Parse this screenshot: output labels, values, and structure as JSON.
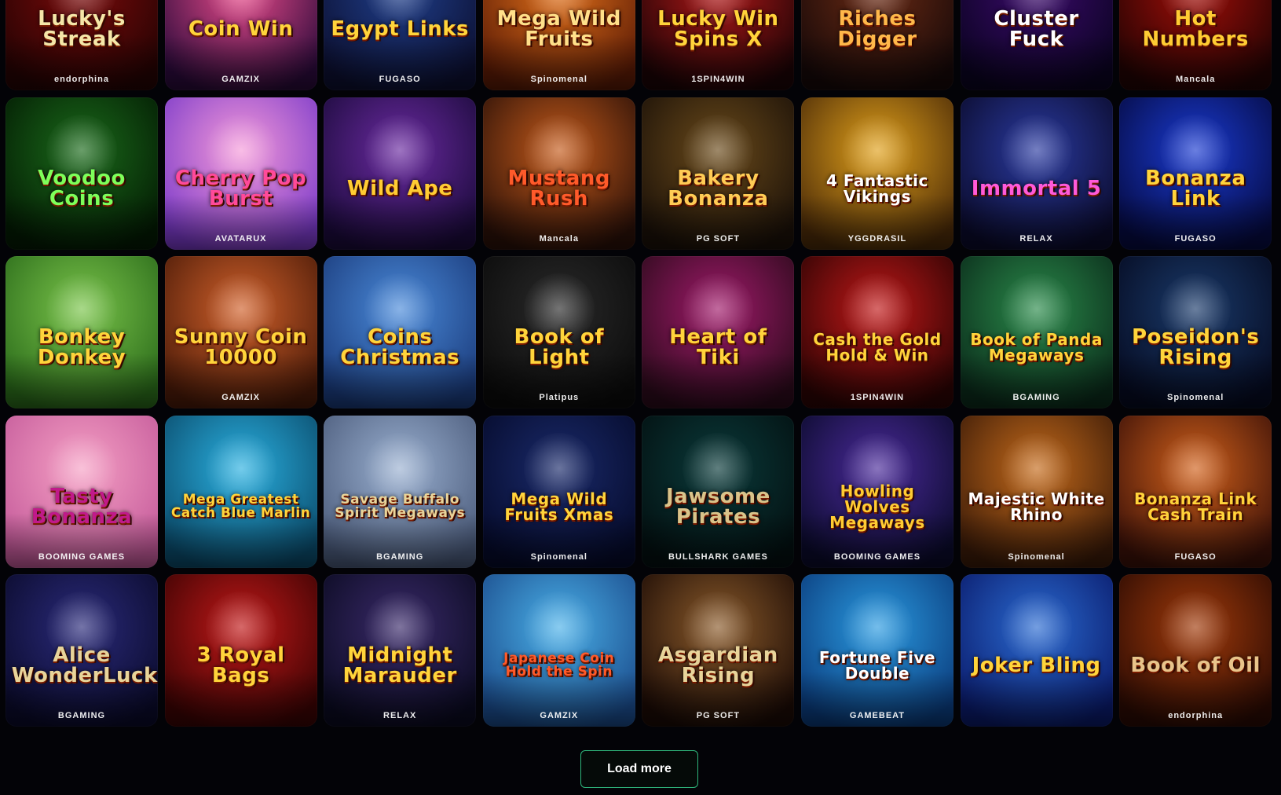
{
  "games": [
    {
      "title": "Lucky's Streak",
      "provider": "endorphina",
      "bg": [
        "#7a0a0a",
        "#240303"
      ],
      "color": "#f5e6a8",
      "art": "flames"
    },
    {
      "title": "Coin Win",
      "provider": "GAMZIX",
      "bg": [
        "#e84a8a",
        "#2a0a3a"
      ],
      "color": "#ffd43b",
      "art": "coins"
    },
    {
      "title": "Egypt Links",
      "provider": "FUGASO",
      "bg": [
        "#1f3e8a",
        "#0c0f30"
      ],
      "color": "#ffd43b",
      "art": "sun"
    },
    {
      "title": "Mega Wild Fruits",
      "provider": "Spinomenal",
      "bg": [
        "#e0701a",
        "#5a1a05"
      ],
      "color": "#ffe08a",
      "art": "crown"
    },
    {
      "title": "Lucky Win Spins X",
      "provider": "1SPIN4WIN",
      "bg": [
        "#b01818",
        "#1a0305"
      ],
      "color": "#ffd43b",
      "art": "fruit"
    },
    {
      "title": "Riches Digger",
      "provider": "",
      "bg": [
        "#6a2a14",
        "#150808"
      ],
      "color": "#ffb84a",
      "art": "miner"
    },
    {
      "title": "Cluster Fuck",
      "provider": "",
      "bg": [
        "#3a0a6a",
        "#0a0320"
      ],
      "color": "#ffffff",
      "art": "devil"
    },
    {
      "title": "Hot Numbers",
      "provider": "Mancala",
      "bg": [
        "#a10e08",
        "#200303"
      ],
      "color": "#ffcc33",
      "art": "flames"
    },
    {
      "title": "Voodoo Coins",
      "provider": "",
      "bg": [
        "#1a6a1a",
        "#031a03"
      ],
      "color": "#7dff5a",
      "art": "skull"
    },
    {
      "title": "Cherry Pop Burst",
      "provider": "AVATARUX",
      "bg": [
        "#f59ad9",
        "#7a3ac9"
      ],
      "color": "#ff4a9a",
      "art": "cherry"
    },
    {
      "title": "Wild Ape",
      "provider": "",
      "bg": [
        "#6a2aa0",
        "#1a0a3a"
      ],
      "color": "#ffcc33",
      "art": "ape"
    },
    {
      "title": "Mustang Rush",
      "provider": "Mancala",
      "bg": [
        "#c45a1a",
        "#2a1008"
      ],
      "color": "#ff5a2a",
      "art": "cowgirl"
    },
    {
      "title": "Bakery Bonanza",
      "provider": "PG SOFT",
      "bg": [
        "#6a4a1a",
        "#1a1008"
      ],
      "color": "#ffcc55",
      "art": "cake"
    },
    {
      "title": "4 Fantastic Vikings",
      "provider": "YGGDRASIL",
      "bg": [
        "#e0a01a",
        "#4a2a08"
      ],
      "color": "#ffffff",
      "art": "viking"
    },
    {
      "title": "Immortal 5",
      "provider": "RELAX",
      "bg": [
        "#2a3aa0",
        "#0a0a2a"
      ],
      "color": "#ff5ad9",
      "art": "heroes"
    },
    {
      "title": "Bonanza Link",
      "provider": "FUGASO",
      "bg": [
        "#1a3ad0",
        "#050a40"
      ],
      "color": "#ffd43b",
      "art": "dollar"
    },
    {
      "title": "Bonkey Donkey",
      "provider": "",
      "bg": [
        "#7ac44a",
        "#2a6a1a"
      ],
      "color": "#ffd43b",
      "art": "donkey"
    },
    {
      "title": "Sunny Coin 10000",
      "provider": "GAMZIX",
      "bg": [
        "#d0602a",
        "#4a1a08"
      ],
      "color": "#ffd43b",
      "art": "queen"
    },
    {
      "title": "Coins Christmas",
      "provider": "",
      "bg": [
        "#4a8ad9",
        "#1a3a7a"
      ],
      "color": "#ffd43b",
      "art": "snow"
    },
    {
      "title": "Book of Light",
      "provider": "Platipus",
      "bg": [
        "#2a2a2a",
        "#0a0a0a"
      ],
      "color": "#ffd43b",
      "art": "pharaoh"
    },
    {
      "title": "Heart of Tiki",
      "provider": "",
      "bg": [
        "#a01a6a",
        "#2a0a1a"
      ],
      "color": "#ffd43b",
      "art": "volcano"
    },
    {
      "title": "Cash the Gold Hold & Win",
      "provider": "1SPIN4WIN",
      "bg": [
        "#c01818",
        "#2a0303"
      ],
      "color": "#ffd43b",
      "art": "goldcoin"
    },
    {
      "title": "Book of Panda Megaways",
      "provider": "BGAMING",
      "bg": [
        "#2a8a4a",
        "#0a2a1a"
      ],
      "color": "#ffd43b",
      "art": "panda"
    },
    {
      "title": "Poseidon's Rising",
      "provider": "Spinomenal",
      "bg": [
        "#1a3a6a",
        "#050a20"
      ],
      "color": "#ffd43b",
      "art": "poseidon"
    },
    {
      "title": "Tasty Bonanza",
      "provider": "BOOMING GAMES",
      "bg": [
        "#f5a0c4",
        "#c45a9a"
      ],
      "color": "#c01a8a",
      "art": "candy"
    },
    {
      "title": "Mega Greatest Catch Blue Marlin",
      "provider": "",
      "bg": [
        "#2ab0e0",
        "#0a4a6a"
      ],
      "color": "#ffd43b",
      "art": "fisher"
    },
    {
      "title": "Savage Buffalo Spirit Megaways",
      "provider": "BGAMING",
      "bg": [
        "#9ab0d0",
        "#4a5a7a"
      ],
      "color": "#e8d49a",
      "art": "buffalo"
    },
    {
      "title": "Mega Wild Fruits Xmas",
      "provider": "Spinomenal",
      "bg": [
        "#1a2a6a",
        "#050a2a"
      ],
      "color": "#ffd43b",
      "art": "fruits"
    },
    {
      "title": "Jawsome Pirates",
      "provider": "BULLSHARK GAMES",
      "bg": [
        "#0a3a3a",
        "#030f10"
      ],
      "color": "#d9c48a",
      "art": "skeleton"
    },
    {
      "title": "Howling Wolves Megaways",
      "provider": "BOOMING GAMES",
      "bg": [
        "#4a2a9a",
        "#0a0a2a"
      ],
      "color": "#ffcc33",
      "art": "wolf"
    },
    {
      "title": "Majestic White Rhino",
      "provider": "Spinomenal",
      "bg": [
        "#c46a1a",
        "#3a1a08"
      ],
      "color": "#ffffff",
      "art": "rhino"
    },
    {
      "title": "Bonanza Link Cash Train",
      "provider": "FUGASO",
      "bg": [
        "#d0601a",
        "#3a1008"
      ],
      "color": "#ffd43b",
      "art": "train"
    },
    {
      "title": "Alice WonderLuck",
      "provider": "BGAMING",
      "bg": [
        "#2a2a7a",
        "#0a0a2a"
      ],
      "color": "#e8d49a",
      "art": "alice"
    },
    {
      "title": "3 Royal Bags",
      "provider": "",
      "bg": [
        "#c01818",
        "#3a0303"
      ],
      "color": "#ffd43b",
      "art": "bags"
    },
    {
      "title": "Midnight Marauder",
      "provider": "RELAX",
      "bg": [
        "#3a2a6a",
        "#0a0a20"
      ],
      "color": "#ffd43b",
      "art": "thief"
    },
    {
      "title": "Japanese Coin Hold the Spin",
      "provider": "GAMZIX",
      "bg": [
        "#4ab0e8",
        "#1a4a8a"
      ],
      "color": "#ff5a2a",
      "art": "goldcoin"
    },
    {
      "title": "Asgardian Rising",
      "provider": "PG SOFT",
      "bg": [
        "#8a5a2a",
        "#1a0a05"
      ],
      "color": "#e8d49a",
      "art": "warrior"
    },
    {
      "title": "Fortune Five Double",
      "provider": "GAMEBEAT",
      "bg": [
        "#2a9ae0",
        "#0a3a7a"
      ],
      "color": "#ffffff",
      "art": "seven"
    },
    {
      "title": "Joker Bling",
      "provider": "",
      "bg": [
        "#2a6ad0",
        "#0a1a6a"
      ],
      "color": "#ffd43b",
      "art": "joker"
    },
    {
      "title": "Book of Oil",
      "provider": "endorphina",
      "bg": [
        "#a03a0a",
        "#2a0a03"
      ],
      "color": "#e8c48a",
      "art": "book"
    }
  ],
  "load_more": {
    "label": "Load more"
  }
}
